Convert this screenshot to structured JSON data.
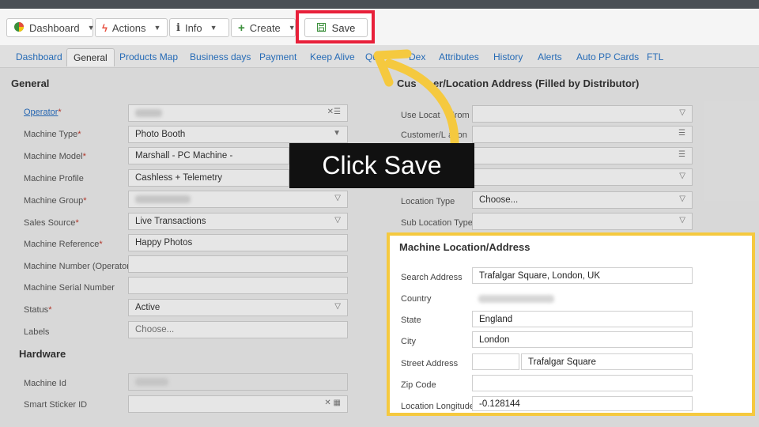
{
  "toolbar": {
    "dashboard_label": "Dashboard",
    "actions_label": "Actions",
    "info_label": "Info",
    "create_label": "Create",
    "save_label": "Save"
  },
  "tabs": [
    "Dashboard",
    "General",
    "Products Map",
    "Business days",
    "Payment",
    "Keep Alive",
    "Qu",
    "Dex",
    "Attributes",
    "History",
    "Alerts",
    "Auto PP Cards",
    "FTL"
  ],
  "general": {
    "title": "General",
    "fields": [
      {
        "label": "Operator",
        "value": ""
      },
      {
        "label": "Machine Type",
        "value": "Photo Booth"
      },
      {
        "label": "Machine Model",
        "value": "Marshall - PC Machine -"
      },
      {
        "label": "Machine Profile",
        "value": "Cashless + Telemetry"
      },
      {
        "label": "Machine Group",
        "value": ""
      },
      {
        "label": "Sales Source",
        "value": "Live Transactions"
      },
      {
        "label": "Machine Reference",
        "value": "Happy Photos"
      },
      {
        "label": "Machine Number (Operator)",
        "value": ""
      },
      {
        "label": "Machine Serial Number",
        "value": ""
      },
      {
        "label": "Status",
        "value": "Active"
      },
      {
        "label": "Labels",
        "value": "Choose..."
      }
    ],
    "required_mark": "*"
  },
  "hardware": {
    "title": "Hardware",
    "fields": [
      {
        "label": "Machine Id",
        "value": ""
      },
      {
        "label": "Smart Sticker ID",
        "value": ""
      }
    ]
  },
  "customer": {
    "title": "Customer/Location Address (Filled by Distributor)",
    "title_visible_start": "Cus",
    "title_visible_end": "er/Location Address (Filled by Distributor)",
    "fields": [
      {
        "label": "Use Location From",
        "label_visible": "Use Locat",
        "label_visible_end": "From",
        "value": ""
      },
      {
        "label": "Customer/Location",
        "label_visible": "Customer/L",
        "label_visible_end": "ation",
        "value": ""
      },
      {
        "label": "Location Type",
        "value": "Choose..."
      },
      {
        "label": "Sub Location Type",
        "value": ""
      }
    ]
  },
  "location": {
    "title": "Machine Location/Address",
    "fields": [
      {
        "label": "Search Address",
        "value": "Trafalgar Square, London, UK"
      },
      {
        "label": "Country",
        "value": ""
      },
      {
        "label": "State",
        "value": "England"
      },
      {
        "label": "City",
        "value": "London"
      },
      {
        "label": "Street Address",
        "value": "",
        "value2": "Trafalgar Square"
      },
      {
        "label": "Zip Code",
        "value": ""
      },
      {
        "label": "Location Longitude",
        "value": "-0.128144"
      }
    ]
  },
  "callout": {
    "text": "Click Save"
  },
  "colors": {
    "highlight_red": "#e8203a",
    "highlight_yellow": "#f5c93f",
    "link_blue": "#2a75c6"
  }
}
